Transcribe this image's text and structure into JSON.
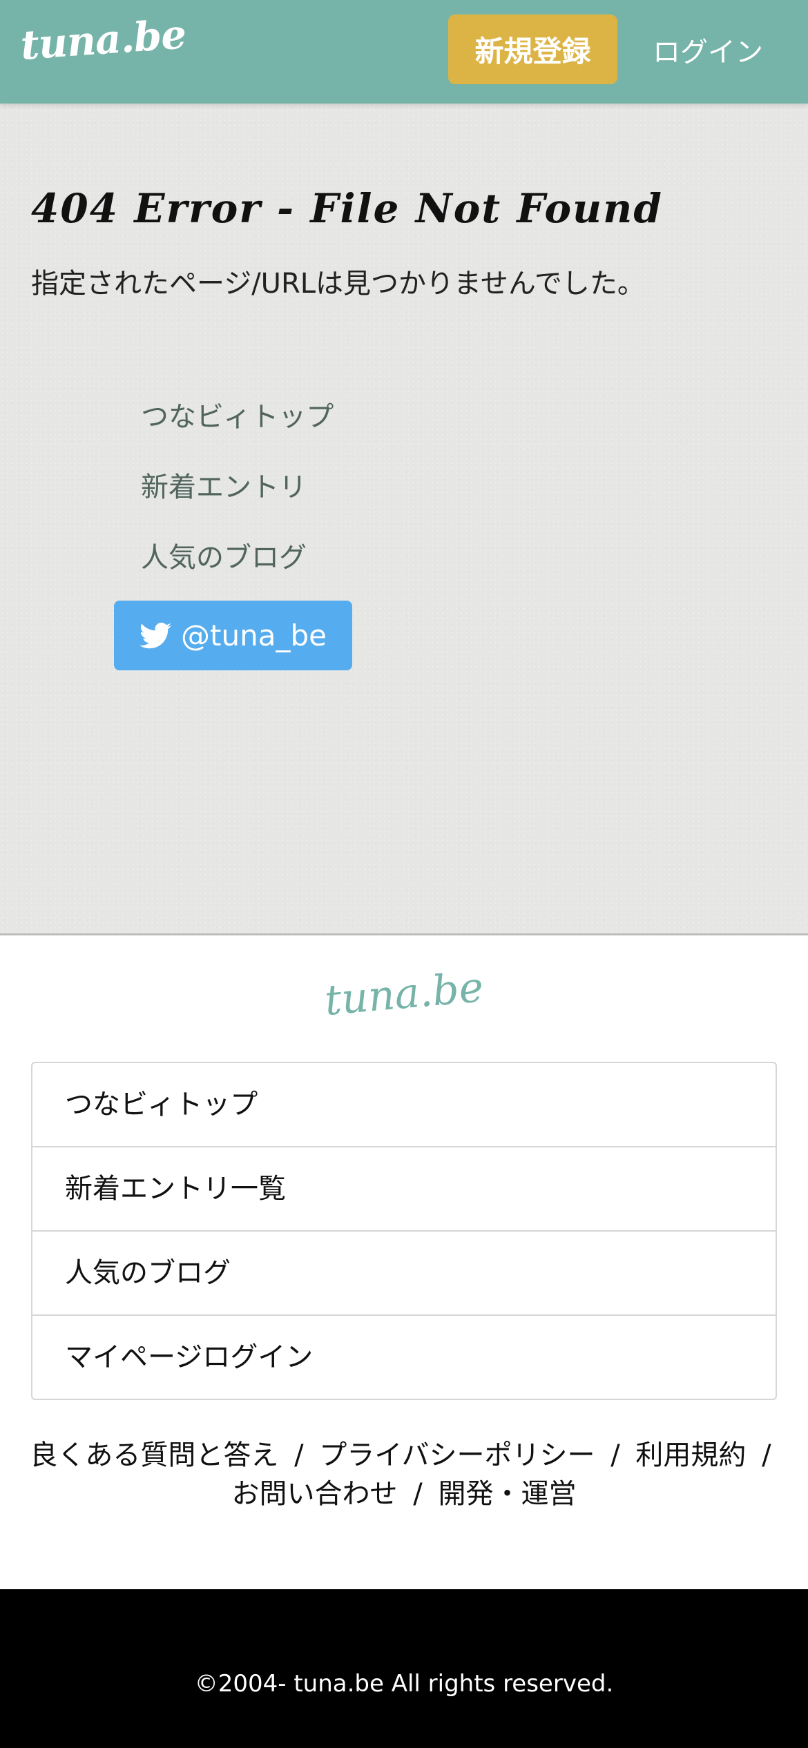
{
  "header": {
    "logo": "tuna.be",
    "register_label": "新規登録",
    "login_label": "ログイン"
  },
  "error": {
    "title": "404 Error - File Not Found",
    "message": "指定されたページ/URLは見つかりませんでした。"
  },
  "main_links": [
    {
      "label": "つなビィトップ"
    },
    {
      "label": "新着エントリ"
    },
    {
      "label": "人気のブログ"
    }
  ],
  "twitter": {
    "icon": "twitter-bird-icon",
    "label": "@tuna_be",
    "color": "#55acee"
  },
  "footer": {
    "logo": "tuna.be",
    "list": [
      {
        "label": "つなビィトップ"
      },
      {
        "label": "新着エントリ一覧"
      },
      {
        "label": "人気のブログ"
      },
      {
        "label": "マイページログイン"
      }
    ],
    "links": {
      "faq": "良くある質問と答え",
      "privacy": "プライバシーポリシー",
      "terms": "利用規約",
      "contact": "お問い合わせ",
      "dev": "開発・運営",
      "separator": "/"
    },
    "copyright": "©2004- tuna.be All rights reserved."
  },
  "colors": {
    "header_bg": "#76b3a8",
    "register_bg": "#dcb446",
    "main_bg": "#e6e6e4",
    "copyright_bg": "#000000"
  }
}
